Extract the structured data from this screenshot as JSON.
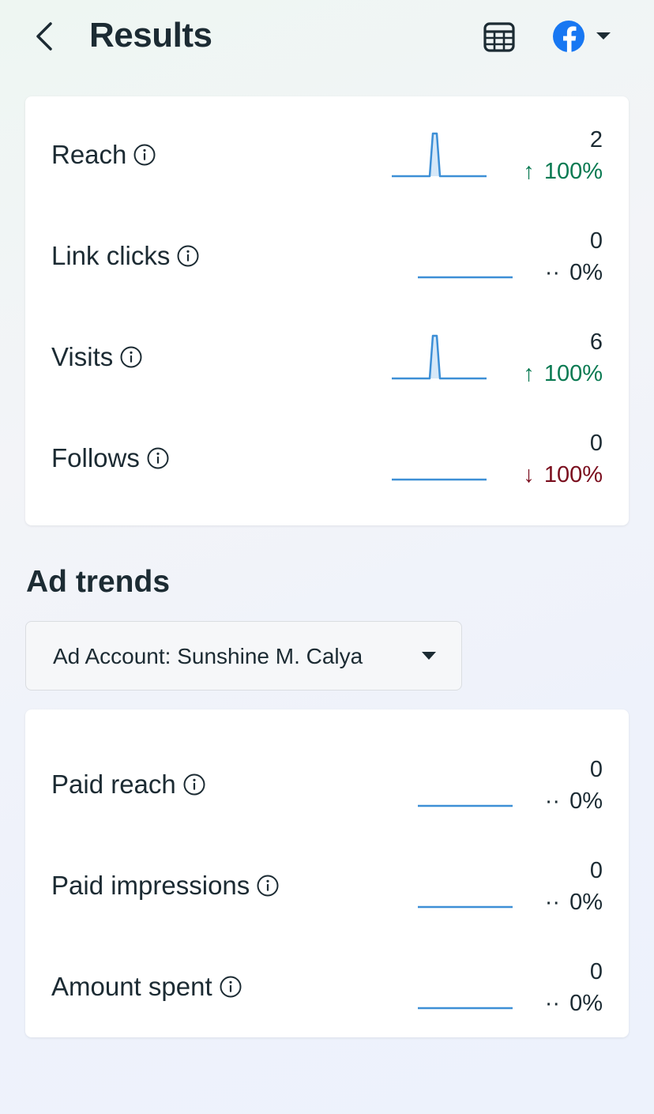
{
  "header": {
    "title": "Results"
  },
  "results": [
    {
      "label": "Reach",
      "value": "2",
      "change": "100%",
      "direction": "up",
      "spark": "spike"
    },
    {
      "label": "Link clicks",
      "value": "0",
      "change": "0%",
      "direction": "neutral",
      "spark": "flat"
    },
    {
      "label": "Visits",
      "value": "6",
      "change": "100%",
      "direction": "up",
      "spark": "spike"
    },
    {
      "label": "Follows",
      "value": "0",
      "change": "100%",
      "direction": "down",
      "spark": "flat"
    }
  ],
  "ad_trends": {
    "title": "Ad trends",
    "account_dropdown": "Ad Account: Sunshine M. Calya",
    "metrics": [
      {
        "label": "Paid reach",
        "value": "0",
        "change": "0%",
        "direction": "neutral",
        "spark": "flat"
      },
      {
        "label": "Paid impressions",
        "value": "0",
        "change": "0%",
        "direction": "neutral",
        "spark": "flat"
      },
      {
        "label": "Amount spent",
        "value": "0",
        "change": "0%",
        "direction": "neutral",
        "spark": "flat"
      }
    ]
  },
  "colors": {
    "up": "#0a7a52",
    "down": "#7a0e1e",
    "spark": "#3d8fd6",
    "facebook": "#1877f2"
  },
  "icons": [
    "back-chevron-icon",
    "calendar-icon",
    "facebook-icon",
    "caret-down-icon",
    "info-icon"
  ]
}
